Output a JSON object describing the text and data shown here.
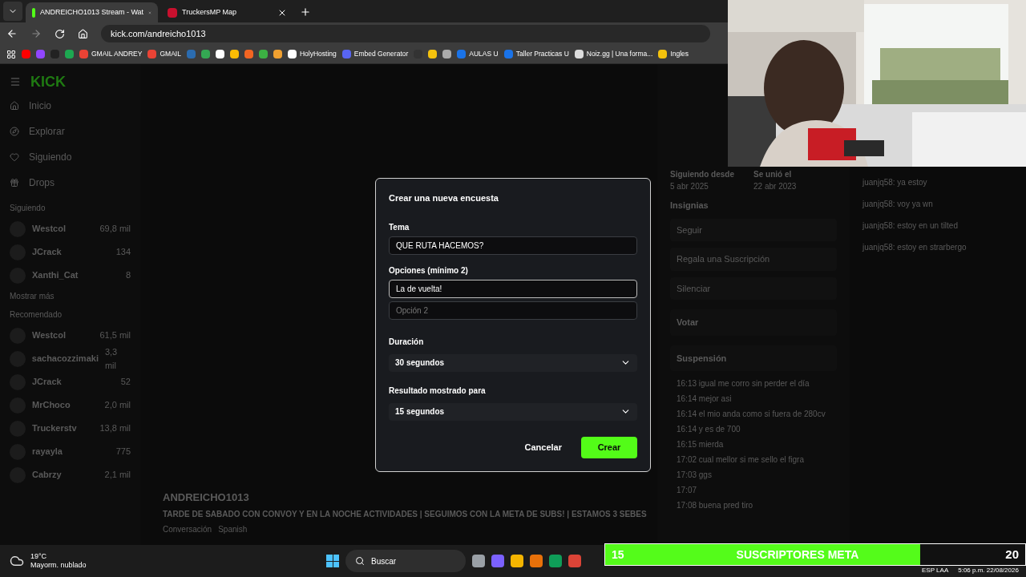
{
  "browser": {
    "tabs": [
      {
        "title": "ANDREICHO1013 Stream - Wat",
        "selected": true,
        "color": "#53fc18"
      },
      {
        "title": "TruckersMP Map",
        "selected": false,
        "color": "#c8102e"
      }
    ],
    "url": "kick.com/andreicho1013",
    "bookmarks": [
      {
        "color": "#ff0000"
      },
      {
        "color": "#9146ff"
      },
      {
        "color": "#222222"
      },
      {
        "color": "#1da851"
      },
      {
        "label": "GMAIL ANDREY",
        "color": "#ea4335"
      },
      {
        "label": "GMAIL",
        "color": "#ea4335"
      },
      {
        "color": "#2b6cb0"
      },
      {
        "color": "#34a853"
      },
      {
        "color": "#ffffff"
      },
      {
        "color": "#fbbc04"
      },
      {
        "color": "#f26522"
      },
      {
        "color": "#3cb043"
      },
      {
        "color": "#f0a030"
      },
      {
        "label": "HolyHosting",
        "color": "#ffffff"
      },
      {
        "label": "Embed Generator",
        "color": "#5865f2"
      },
      {
        "color": "#333333"
      },
      {
        "color": "#f4c20d"
      },
      {
        "color": "#aaaaaa"
      },
      {
        "label": "AULAS U",
        "color": "#1a73e8"
      },
      {
        "label": "Taller Practicas U",
        "color": "#1a73e8"
      },
      {
        "label": "Noiz.gg | Una forma...",
        "color": "#dddddd"
      },
      {
        "label": "Ingles",
        "color": "#f4c20d"
      }
    ]
  },
  "page": {
    "logo": "KICK",
    "nav": [
      {
        "label": "Inicio"
      },
      {
        "label": "Explorar"
      },
      {
        "label": "Siguiendo"
      },
      {
        "label": "Drops"
      }
    ],
    "sections": [
      {
        "title": "Siguiendo",
        "channels": [
          {
            "name": "Westcol",
            "viewers": "69,8 mil"
          },
          {
            "name": "JCrack",
            "viewers": "134"
          },
          {
            "name": "Xanthi_Cat",
            "viewers": "8"
          }
        ],
        "more": "Mostrar más"
      },
      {
        "title": "Recomendado",
        "channels": [
          {
            "name": "Westcol",
            "viewers": "61,5 mil"
          },
          {
            "name": "sachacozzimaki",
            "viewers": "3,3 mil"
          },
          {
            "name": "JCrack",
            "viewers": "52"
          },
          {
            "name": "MrChoco",
            "viewers": "2,0 mil"
          },
          {
            "name": "Truckerstv",
            "viewers": "13,8 mil"
          },
          {
            "name": "rayayla",
            "viewers": "775"
          },
          {
            "name": "Cabrzy",
            "viewers": "2,1 mil"
          }
        ]
      }
    ],
    "streamer": {
      "name": "ANDREICHO1013",
      "title": "TARDE DE SABADO CON CONVOY Y EN LA NOCHE ACTIVIDADES | SEGUIMOS CON LA META DE SUBS! | ESTAMOS 3 SEBES",
      "tags": [
        "Conversación",
        "Spanish"
      ]
    },
    "profile": {
      "facts": [
        {
          "label": "Siguiendo desde",
          "value": "5 abr 2025"
        },
        {
          "label": "Se unió el",
          "value": "22 abr 2023"
        }
      ],
      "badges_label": "Insignias",
      "actions": [
        "Seguir",
        "Regala una Suscripción",
        "Silenciar"
      ],
      "panels": [
        "Votar",
        "Suspensión"
      ],
      "log": [
        "16:13 igual me corro sin perder el día",
        "16:14 mejor asi",
        "16:14 el mio anda como si fuera de 280cv",
        "16:14 y es de 700",
        "16:15 mierda",
        "17:02 cual mellor si me sello el figra",
        "17:03 ggs",
        "17:07",
        "17:08 buena pred tiro"
      ]
    },
    "chat": [
      "juanjq58: ya estoy",
      "juanjq58: voy ya wn",
      "juanjq58: estoy en un tilted",
      "juanjq58: estoy en strarbergo"
    ]
  },
  "modal": {
    "title": "Crear una nueva encuesta",
    "topic": {
      "label": "Tema",
      "value": "QUE RUTA HACEMOS?"
    },
    "options": {
      "label": "Opciones (mínimo 2)",
      "fields": [
        {
          "value": "La de vuelta!"
        },
        {
          "placeholder": "Opción 2"
        }
      ]
    },
    "selects": [
      {
        "label": "Duración",
        "value": "30 segundos"
      },
      {
        "label": "Resultado mostrado para",
        "value": "15 segundos"
      }
    ],
    "buttons": [
      {
        "label": "Cancelar",
        "kind": "secondary"
      },
      {
        "label": "Crear",
        "kind": "primary"
      }
    ]
  },
  "goal": {
    "current": "15",
    "label": "SUSCRIPTORES META",
    "target": "20",
    "level": 0.75
  },
  "taskbar": {
    "weather": {
      "temp": "19°C",
      "condition": "Mayorm. nublado"
    },
    "search": {
      "placeholder": "Buscar"
    },
    "apps": [
      {
        "color": "#9aa0a6"
      },
      {
        "color": "#7b61ff"
      },
      {
        "color": "#f4b400"
      },
      {
        "color": "#e8710a"
      },
      {
        "color": "#0f9d58"
      },
      {
        "color": "#db4437"
      }
    ],
    "lang": "ESP",
    "layout": "LAA",
    "time": "5:06 p.m.",
    "date": "22/08/2026"
  }
}
